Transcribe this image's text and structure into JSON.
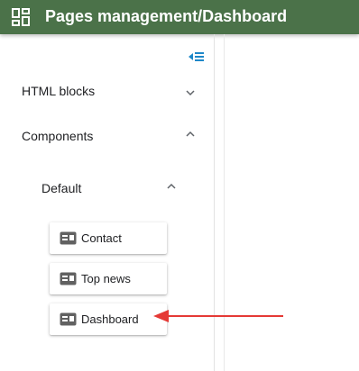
{
  "header": {
    "title": "Pages management/Dashboard",
    "background": "#4b7249",
    "icon": "dashboard-grid-icon"
  },
  "sidebar": {
    "collapse_icon": "collapse-sidebar-icon",
    "sections": [
      {
        "label": "HTML blocks",
        "expanded": false,
        "icon": "chevron-down-icon"
      },
      {
        "label": "Components",
        "expanded": true,
        "icon": "chevron-up-icon"
      }
    ],
    "group": {
      "label": "Default",
      "expanded": true,
      "icon": "chevron-up-icon"
    },
    "components": [
      {
        "label": "Contact",
        "icon": "component-icon"
      },
      {
        "label": "Top news",
        "icon": "component-icon"
      },
      {
        "label": "Dashboard",
        "icon": "component-icon"
      }
    ]
  },
  "annotation": {
    "type": "arrow",
    "color": "#e53935",
    "target": "Dashboard"
  }
}
